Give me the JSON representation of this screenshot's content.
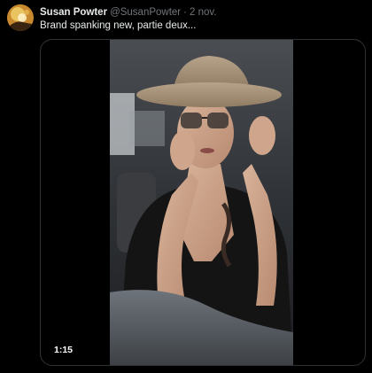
{
  "tweet": {
    "author_name": "Susan Powter",
    "author_handle": "@SusanPowter",
    "separator": "·",
    "date": "2 nov.",
    "text": "Brand spanking new, partie deux...",
    "video": {
      "duration": "1:15"
    }
  },
  "icons": {
    "avatar": "profile-avatar"
  },
  "colors": {
    "background": "#000000",
    "primary_text": "#e7e9ea",
    "secondary_text": "#71767b",
    "border": "#2f3336"
  }
}
